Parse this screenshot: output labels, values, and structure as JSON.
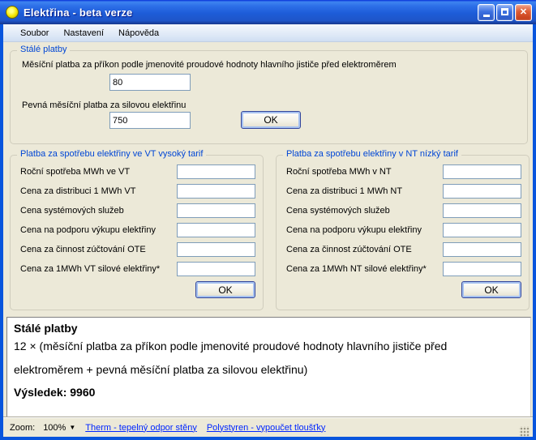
{
  "window": {
    "title": "Elektřina - beta verze",
    "min_label": "minimize",
    "max_label": "maximize",
    "close_label": "✕"
  },
  "menu": {
    "items": [
      {
        "label": "Soubor"
      },
      {
        "label": "Nastavení"
      },
      {
        "label": "Nápověda"
      }
    ]
  },
  "fixed_payments": {
    "title": "Stálé platby",
    "field1_label": "Měsíční platba za příkon podle jmenovité proudové hodnoty hlavního jističe před elektroměrem",
    "field1_value": "80",
    "field2_label": "Pevná měsíční platba za silovou elektřinu",
    "field2_value": "750",
    "ok_label": "OK"
  },
  "vt": {
    "title": "Platba za spotřebu elektřiny ve VT vysoký tarif",
    "rows": [
      {
        "label": "Roční spotřeba MWh ve VT",
        "value": ""
      },
      {
        "label": "Cena za distribuci 1 MWh VT",
        "value": ""
      },
      {
        "label": "Cena systémových služeb",
        "value": ""
      },
      {
        "label": "Cena na podporu výkupu elektřiny",
        "value": ""
      },
      {
        "label": "Cena za činnost zúčtování OTE",
        "value": ""
      },
      {
        "label": "Cena za 1MWh VT silové elektřiny*",
        "value": ""
      }
    ],
    "ok_label": "OK"
  },
  "nt": {
    "title": "Platba za spotřebu elektřiny v NT nízký tarif",
    "rows": [
      {
        "label": "Roční spotřeba MWh v NT",
        "value": ""
      },
      {
        "label": "Cena za distribuci 1 MWh NT",
        "value": ""
      },
      {
        "label": "Cena systémových služeb",
        "value": ""
      },
      {
        "label": "Cena na podporu výkupu elektřiny",
        "value": ""
      },
      {
        "label": "Cena za činnost zúčtování OTE",
        "value": ""
      },
      {
        "label": "Cena za 1MWh NT silové elektřiny*",
        "value": ""
      }
    ],
    "ok_label": "OK"
  },
  "result": {
    "heading": "Stálé platby",
    "line1": "12 × (měsíční platba za příkon podle jmenovité proudové hodnoty hlavního jističe před",
    "line2": "elektroměrem + pevná měsíční platba za silovou elektřinu)",
    "total": "Výsledek: 9960"
  },
  "statusbar": {
    "zoom_label": "Zoom:",
    "zoom_value": "100%",
    "links": [
      {
        "label": "Therm - tepelný odpor stěny"
      },
      {
        "label": "Polystyren - vypoučet tloušťky"
      }
    ]
  },
  "colors": {
    "titlebar_blue": "#1D5CD8",
    "window_border_blue": "#0855DD",
    "groupbox_caption_blue": "#0046D5",
    "link_blue": "#0026FF",
    "client_beige": "#ECE9D8",
    "close_button_red": "#D9512C",
    "input_border": "#7F9DB9"
  }
}
